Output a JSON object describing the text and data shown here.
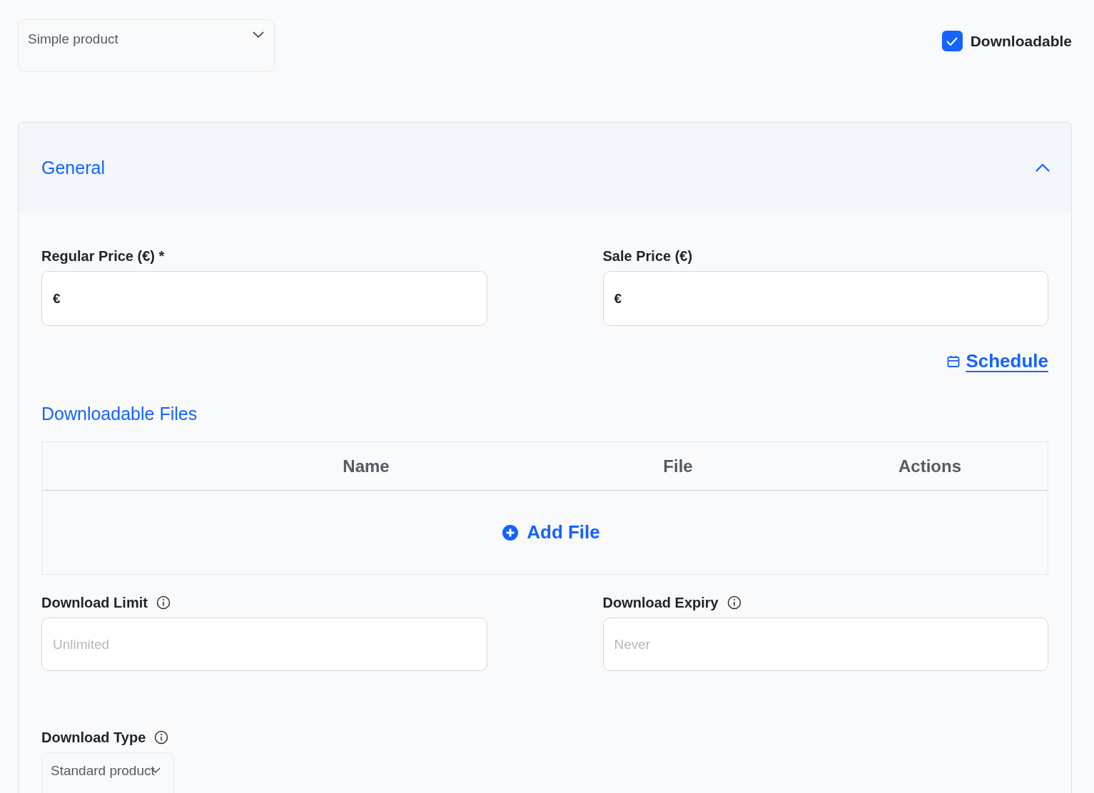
{
  "product_type": {
    "value": "Simple product"
  },
  "downloadable": {
    "label": "Downloadable",
    "checked": true
  },
  "section": {
    "title": "General",
    "expanded": true,
    "price_fields": [
      {
        "label": "Regular Price (€)",
        "required_mark": "*",
        "prefix": "€"
      },
      {
        "label": "Sale Price (€)",
        "prefix": "€"
      }
    ],
    "schedule_link": "Schedule",
    "files": {
      "title": "Downloadable Files",
      "columns": [
        "Name",
        "File",
        "Actions"
      ],
      "add_button": "Add File"
    },
    "limit_fields": [
      {
        "label": "Download Limit",
        "placeholder": "Unlimited"
      },
      {
        "label": "Download Expiry",
        "placeholder": "Never"
      }
    ],
    "download_type": {
      "label": "Download Type",
      "value": "Standard product"
    }
  }
}
